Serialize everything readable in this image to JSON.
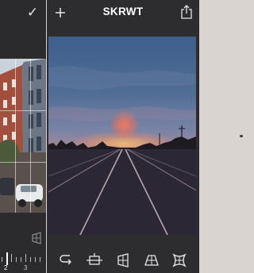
{
  "app": {
    "title": "SKRWT"
  },
  "left_panel": {
    "ruler_labels": [
      "2",
      "3"
    ]
  },
  "toolbar": {
    "tools": [
      "rotate-icon",
      "crop-level-icon",
      "vertical-perspective-icon",
      "horizontal-perspective-icon",
      "lens-distortion-icon"
    ]
  },
  "colors": {
    "screen_bg": "#2d2d30",
    "page_bg": "#d9d4cf",
    "icon": "#e6e6e6"
  }
}
